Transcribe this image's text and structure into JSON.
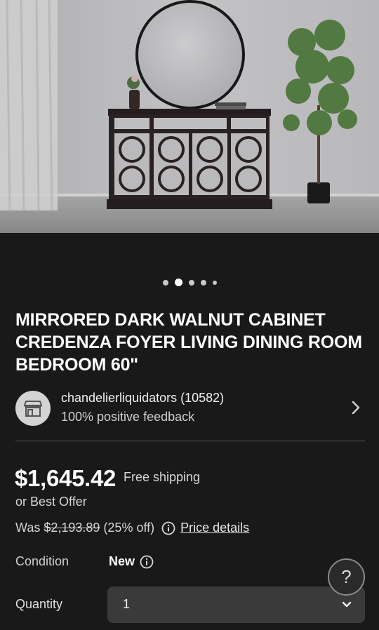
{
  "gallery": {
    "image_alt": "Mirrored dark walnut credenza with round wall mirror and potted tree",
    "dot_count": 5,
    "active_dot_index": 1
  },
  "listing": {
    "title": "MIRRORED DARK WALNUT CABINET CREDENZA FOYER LIVING DINING ROOM BEDROOM 60\""
  },
  "seller": {
    "name": "chandelierliquidators (10582)",
    "feedback": "100% positive feedback",
    "avatar_icon": "store-icon",
    "chevron_icon": "chevron-right-icon"
  },
  "pricing": {
    "price": "$1,645.42",
    "shipping": "Free shipping",
    "best_offer": "or Best Offer",
    "was_label": "Was",
    "was_price": "$2,193.89",
    "discount": "(25% off)",
    "price_details_link": "Price details"
  },
  "condition": {
    "label": "Condition",
    "value": "New"
  },
  "quantity": {
    "label": "Quantity",
    "value": "1"
  },
  "help": {
    "label": "?"
  },
  "colors": {
    "background": "#191919",
    "text_primary": "#ffffff",
    "select_background": "#3a3a3a"
  }
}
